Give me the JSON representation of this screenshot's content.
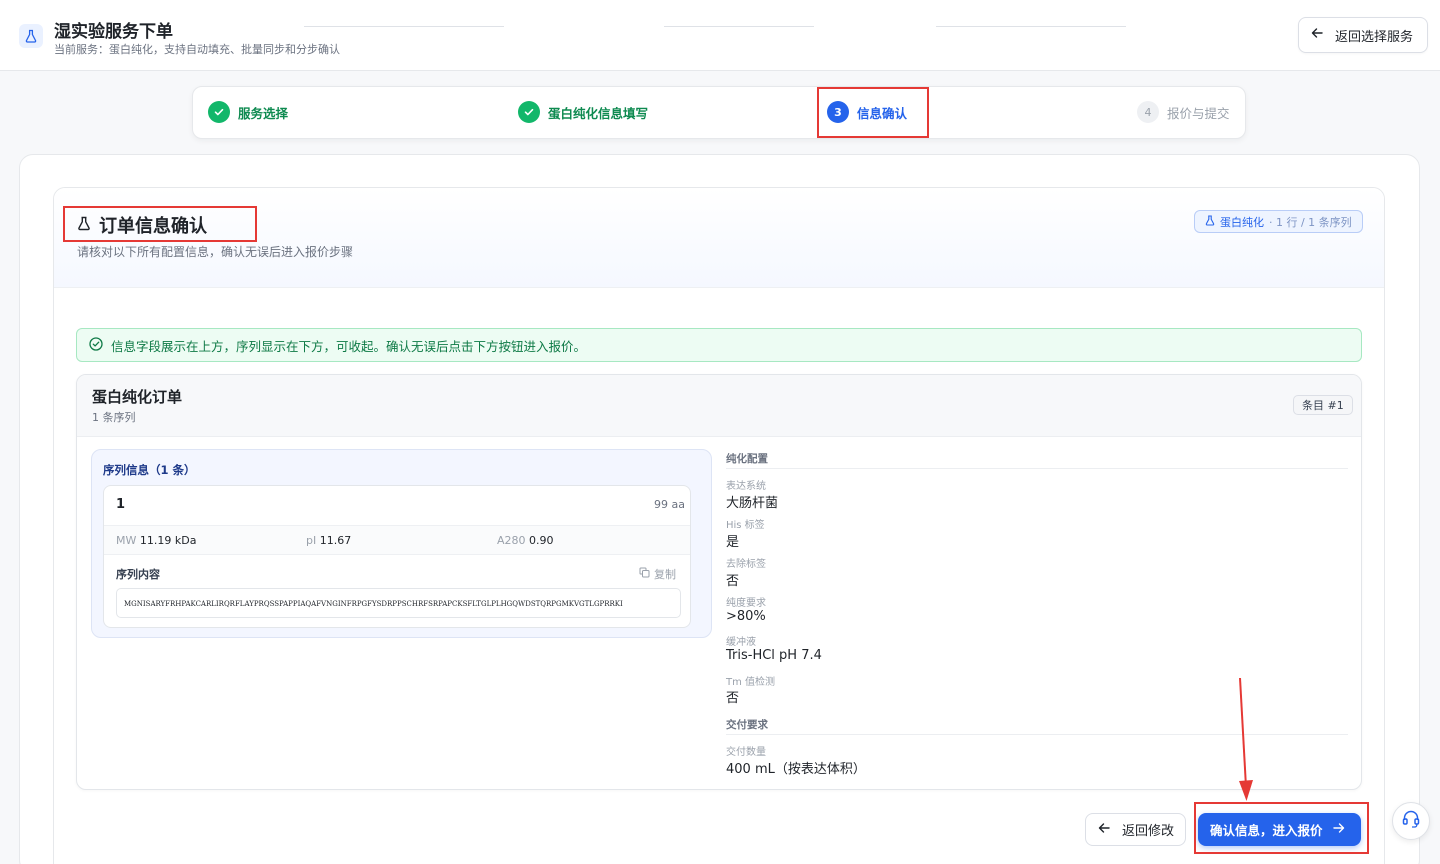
{
  "header": {
    "title": "湿实验服务下单",
    "subtitle": "当前服务：蛋白纯化，支持自动填充、批量同步和分步确认",
    "back_button": "返回选择服务"
  },
  "steps": [
    {
      "number": "1",
      "label": "服务选择",
      "state": "done"
    },
    {
      "number": "2",
      "label": "蛋白纯化信息填写",
      "state": "done"
    },
    {
      "number": "3",
      "label": "信息确认",
      "state": "active"
    },
    {
      "number": "4",
      "label": "报价与提交",
      "state": "todo"
    }
  ],
  "confirm": {
    "title": "订单信息确认",
    "description": "请核对以下所有配置信息，确认无误后进入报价步骤",
    "tag_service": "蛋白纯化",
    "tag_meta": "· 1 行 / 1 条序列",
    "notice": "信息字段展示在上方，序列显示在下方，可收起。确认无误后点击下方按钮进入报价。"
  },
  "order": {
    "title": "蛋白纯化订单",
    "count": "1 条序列",
    "item_tag": "条目 #1",
    "sequence_panel_title": "序列信息（1 条）",
    "sequence": {
      "name": "1",
      "length": "99 aa",
      "mw_label": "MW",
      "mw_value": "11.19 kDa",
      "pi_label": "pI",
      "pi_value": "11.67",
      "a280_label": "A280",
      "a280_value": "0.90",
      "content_label": "序列内容",
      "copy_label": "复制",
      "content": "MGNISARYFRHPAKCARLIRQRFLAYPRQSSPAPPIAQAFVNGINFRPGFYSDRPPSCHRFSRPAPCKSFLTGLPLHGQWDSTQRPGMKVGTLGPRRKI"
    }
  },
  "config": {
    "purification_section": "纯化配置",
    "fields": [
      {
        "key": "表达系统",
        "value": "大肠杆菌"
      },
      {
        "key": "His 标签",
        "value": "是"
      },
      {
        "key": "去除标签",
        "value": "否"
      },
      {
        "key": "纯度要求",
        "value": ">80%"
      },
      {
        "key": "缓冲液",
        "value": "Tris-HCl pH 7.4"
      },
      {
        "key": "Tm 值检测",
        "value": "否"
      }
    ],
    "delivery_section": "交付要求",
    "delivery_fields": [
      {
        "key": "交付数量",
        "value": "400 mL（按表达体积）"
      }
    ]
  },
  "actions": {
    "back_label": "返回修改",
    "confirm_label": "确认信息，进入报价"
  },
  "colors": {
    "primary": "#2563eb",
    "success": "#12b76a",
    "highlight": "#e53935"
  }
}
